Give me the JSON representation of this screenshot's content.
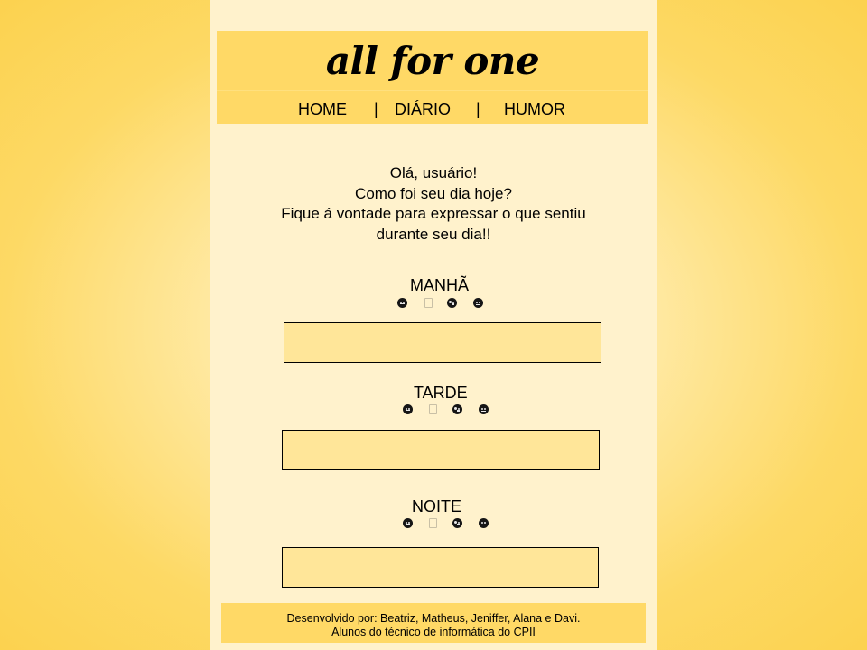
{
  "header": {
    "title": "all for one",
    "nav": {
      "home": "HOME",
      "separator_1": "|",
      "diario": "DIÁRIO",
      "separator_2": "|",
      "humor": "HUMOR"
    }
  },
  "greeting": {
    "line_1": "Olá, usuário!",
    "line_2": "Como foi seu dia hoje?",
    "line_3": "Fique á vontade para expressar o que sentiu",
    "line_4": "durante seu dia!!"
  },
  "periods": [
    {
      "title": "MANHÃ",
      "value": "",
      "emojis": [
        "neutral-face-icon",
        "missing-glyph-icon",
        "tongue-face-icon",
        "sad-face-icon"
      ]
    },
    {
      "title": "TARDE",
      "value": "",
      "emojis": [
        "neutral-face-icon",
        "missing-glyph-icon",
        "tongue-face-icon",
        "sad-face-icon"
      ]
    },
    {
      "title": "NOITE",
      "value": "",
      "emojis": [
        "neutral-face-icon",
        "missing-glyph-icon",
        "tongue-face-icon",
        "sad-face-icon"
      ]
    }
  ],
  "footer": {
    "line_1": "Desenvolvido por: Beatriz, Matheus, Jeniffer, Alana e Davi.",
    "line_2": "Alunos do técnico de informática do CPII"
  },
  "colors": {
    "page_background": "#fcd24f",
    "content_background": "#fff2cc",
    "header_background": "#ffd966",
    "text_box_background": "#ffe699"
  }
}
